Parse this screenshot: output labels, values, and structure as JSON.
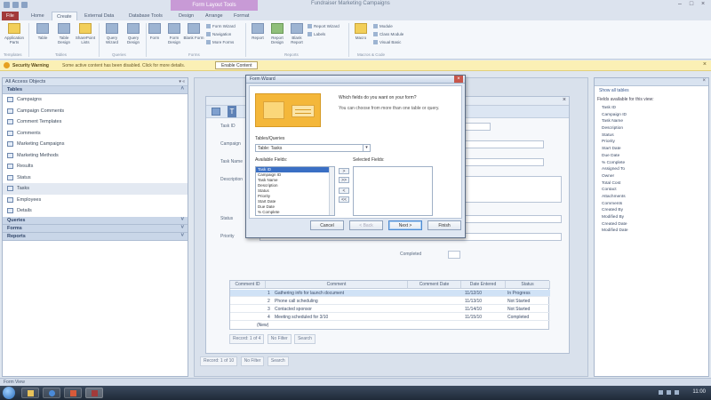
{
  "window": {
    "title": "Fundraiser Marketing Campaigns",
    "context_tab": "Form Layout Tools"
  },
  "ribbon": {
    "tabs": [
      "File",
      "Home",
      "Create",
      "External Data",
      "Database Tools",
      "Design",
      "Arrange",
      "Format"
    ],
    "active_tab": "Create",
    "buttons": [
      {
        "label": "Application Parts"
      },
      {
        "label": "Table"
      },
      {
        "label": "Table Design"
      },
      {
        "label": "SharePoint Lists"
      },
      {
        "label": "Query Wizard"
      },
      {
        "label": "Query Design"
      },
      {
        "label": "Form"
      },
      {
        "label": "Form Design"
      },
      {
        "label": "Blank Form"
      },
      {
        "label": "Report"
      },
      {
        "label": "Report Design"
      },
      {
        "label": "Blank Report"
      },
      {
        "label": "Macro"
      }
    ],
    "small_buttons": [
      "Form Wizard",
      "Navigation",
      "More Forms",
      "Report Wizard",
      "Labels",
      "Module",
      "Class Module",
      "Visual Basic"
    ],
    "groups": [
      "Templates",
      "Tables",
      "Queries",
      "Forms",
      "Reports",
      "Macros & Code"
    ]
  },
  "security": {
    "title": "Security Warning",
    "message": "Some active content has been disabled. Click for more details.",
    "button": "Enable Content"
  },
  "nav": {
    "header": "All Access Objects",
    "groups": {
      "tables": "Tables",
      "queries": "Queries",
      "forms": "Forms",
      "reports": "Reports"
    },
    "items": [
      "Campaigns",
      "Campaign Comments",
      "Comment Templates",
      "Comments",
      "Marketing Campaigns",
      "Marketing Methods",
      "Results",
      "Status",
      "Tasks",
      "Employees",
      "Details"
    ]
  },
  "form": {
    "fields": [
      {
        "label": "Task ID",
        "value": ""
      },
      {
        "label": "Campaign",
        "value": ""
      },
      {
        "label": "Task Name",
        "value": ""
      },
      {
        "label": "Description",
        "value": ""
      },
      {
        "label": "Status",
        "value": ""
      },
      {
        "label": "Priority",
        "value": ""
      },
      {
        "label": "Completed",
        "value": ""
      }
    ],
    "comments": {
      "columns": [
        "Comment ID",
        "Comment",
        "Comment Date",
        "Date Entered",
        "Status"
      ],
      "rows": [
        {
          "id": "1",
          "comment": "Gathering info for launch document",
          "date": "11/12/10",
          "status": "In Progress"
        },
        {
          "id": "2",
          "comment": "Phone call scheduling",
          "date": "11/13/10",
          "status": "Not Started"
        },
        {
          "id": "3",
          "comment": "Contacted sponsor",
          "date": "11/14/10",
          "status": "Not Started"
        },
        {
          "id": "4",
          "comment": "Meeting scheduled for 3/10",
          "date": "11/15/10",
          "status": "Completed"
        }
      ],
      "new_row": "(New)",
      "record_nav": "Record: 1 of 4",
      "filter": "No Filter",
      "search": "Search"
    },
    "record_nav": "Record: 1 of 10",
    "filter": "No Filter",
    "search": "Search"
  },
  "dialog": {
    "title": "Form Wizard",
    "question": "Which fields do you want on your form?",
    "hint": "You can choose from more than one table or query.",
    "tq_label": "Tables/Queries",
    "tq_value": "Table: Tasks",
    "available_label": "Available Fields:",
    "selected_label": "Selected Fields:",
    "available_fields": [
      "Task ID",
      "Campaign ID",
      "Task Name",
      "Description",
      "Status",
      "Priority",
      "Start Date",
      "Due Date",
      "% Complete"
    ],
    "move_buttons": [
      ">",
      ">>",
      "<",
      "<<"
    ],
    "buttons": {
      "cancel": "Cancel",
      "back": "< Back",
      "next": "Next >",
      "finish": "Finish"
    }
  },
  "field_list": {
    "show_all": "Show all tables",
    "caption": "Fields available for this view:",
    "items": [
      "Task ID",
      "Campaign ID",
      "Task Name",
      "Description",
      "Status",
      "Priority",
      "Start Date",
      "Due Date",
      "% Complete",
      "Assigned To",
      "Owner",
      "Total Cost",
      "Contact",
      "Attachments",
      "Comments",
      "Created By",
      "Modified By",
      "Created Date",
      "Modified Date"
    ]
  },
  "status_bar": {
    "text": "Form View"
  },
  "taskbar": {
    "time": "11:00"
  }
}
